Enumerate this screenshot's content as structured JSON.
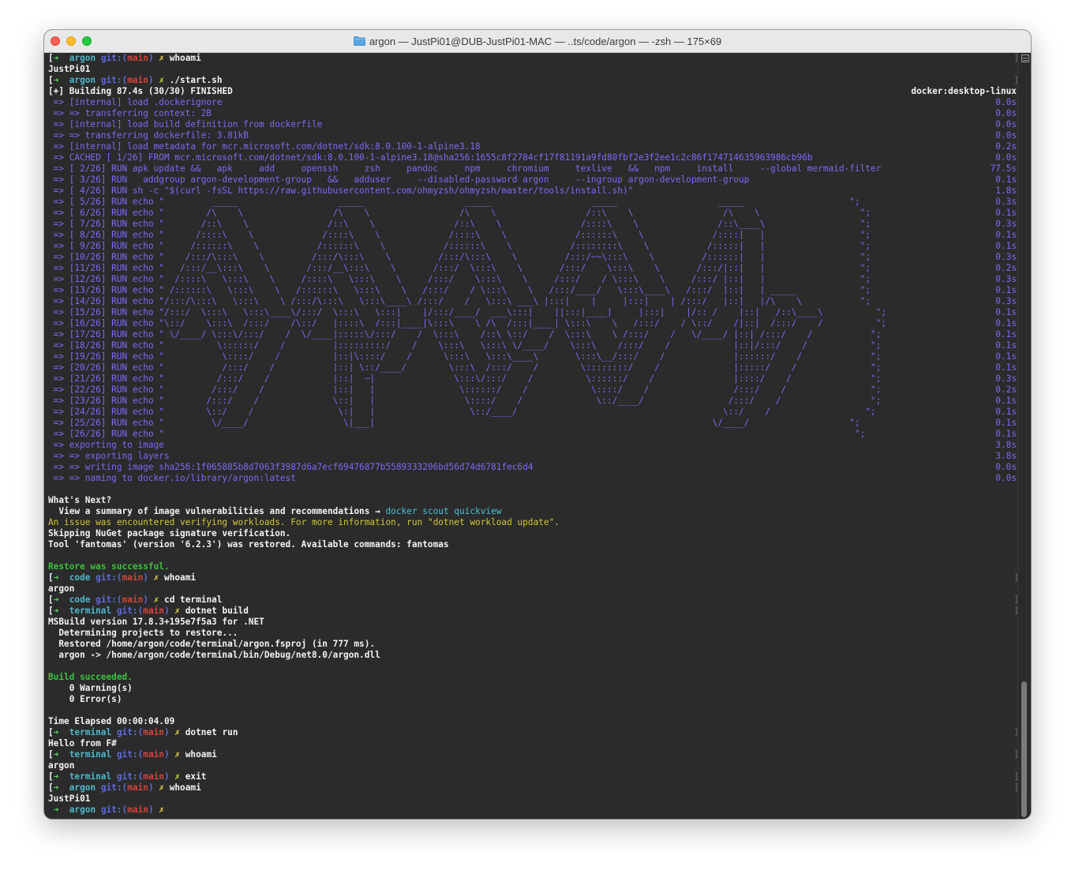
{
  "window": {
    "title": "argon — JustPi01@DUB-JustPi01-MAC — ..ts/code/argon — -zsh — 175×69",
    "icon": "folder-icon"
  },
  "terminal": {
    "lines": [
      {
        "type": "prompt",
        "dir": "argon",
        "branch": "main",
        "cmd": "whoami"
      },
      {
        "type": "plain",
        "text": "JustPi01"
      },
      {
        "type": "prompt",
        "dir": "argon",
        "branch": "main",
        "cmd": "./start.sh"
      },
      {
        "type": "plain",
        "text": "[+] Building 87.4s (30/30) FINISHED",
        "right": "docker:desktop-linux",
        "rightColor": "white"
      },
      {
        "type": "build",
        "text": " => [internal] load .dockerignore",
        "time": "0.0s"
      },
      {
        "type": "build",
        "text": " => => transferring context: 2B",
        "time": "0.0s"
      },
      {
        "type": "build",
        "text": " => [internal] load build definition from dockerfile",
        "time": "0.0s"
      },
      {
        "type": "build",
        "text": " => => transferring dockerfile: 3.81kB",
        "time": "0.0s"
      },
      {
        "type": "build",
        "text": " => [internal] load metadata for mcr.microsoft.com/dotnet/sdk:8.0.100-1-alpine3.18",
        "time": "0.2s"
      },
      {
        "type": "build",
        "text": " => CACHED [ 1/26] FROM mcr.microsoft.com/dotnet/sdk:8.0.100-1-alpine3.18@sha256:1655c8f2784cf17f81191a9fd80fbf2e3f2ee1c2c86f174714635963986cb96b",
        "time": "0.0s"
      },
      {
        "type": "build",
        "text": " => [ 2/26] RUN apk update &&   apk     add     openssh     zsh     pandoc     npm     chromium     texlive   &&   npm     install     --global mermaid-filter",
        "time": "77.5s"
      },
      {
        "type": "build",
        "text": " => [ 3/26] RUN   addgroup argon-development-group   &&   adduser     --disabled-password argon     --ingroup argon-development-group",
        "time": "0.1s"
      },
      {
        "type": "build",
        "text": " => [ 4/26] RUN sh -c \"$(curl -fsSL https://raw.githubusercontent.com/ohmyzsh/ohmyzsh/master/tools/install.sh)\"",
        "time": "1.8s"
      },
      {
        "type": "build",
        "text": " => [ 5/26] RUN echo \"         _____                   _____                   _____                   _____                   _____                    \";",
        "time": "0.3s"
      },
      {
        "type": "build",
        "text": " => [ 6/26] RUN echo \"        /\\    \\                 /\\    \\                 /\\    \\                 /::\\    \\                 /\\    \\                   \";",
        "time": "0.1s"
      },
      {
        "type": "build",
        "text": " => [ 7/26] RUN echo \"       /::\\    \\               /::\\    \\               /::\\    \\               /::::\\    \\               /::\\____\\                  \";",
        "time": "0.3s"
      },
      {
        "type": "build",
        "text": " => [ 8/26] RUN echo \"      /::::\\    \\             /::::\\    \\             /::::\\    \\             /::::::\\    \\             /::::|   |                  \";",
        "time": "0.1s"
      },
      {
        "type": "build",
        "text": " => [ 9/26] RUN echo \"     /::::::\\    \\           /::::::\\    \\           /::::::\\    \\           /::::::::\\    \\           /:::::|   |                  \";",
        "time": "0.1s"
      },
      {
        "type": "build",
        "text": " => [10/26] RUN echo \"    /:::/\\:::\\    \\         /:::/\\:::\\    \\         /:::/\\:::\\    \\         /:::/~~\\:::\\    \\         /::::::|   |                  \";",
        "time": "0.3s"
      },
      {
        "type": "build",
        "text": " => [11/26] RUN echo \"   /:::/__\\:::\\    \\       /:::/__\\:::\\    \\       /:::/  \\:::\\    \\       /:::/    \\:::\\    \\       /:::/|::|   |                  \";",
        "time": "0.2s"
      },
      {
        "type": "build",
        "text": " => [12/26] RUN echo \"  /::::\\   \\:::\\    \\     /::::\\   \\:::\\    \\     /:::/    \\:::\\    \\     /:::/    / \\:::\\    \\     /:::/ |::|   |                  \";",
        "time": "0.3s"
      },
      {
        "type": "build",
        "text": " => [13/26] RUN echo \" /::::::\\   \\:::\\    \\   /::::::\\   \\:::\\    \\   /:::/    / \\:::\\    \\   /:::/____/   \\:::\\____\\   /:::/  |::|   | _____            \";",
        "time": "0.1s"
      },
      {
        "type": "build",
        "text": " => [14/26] RUN echo \"/:::/\\:::\\   \\:::\\    \\ /:::/\\:::\\   \\:::\\____\\ /:::/    /   \\:::\\ ___\\ |:::|    |     |:::|    | /:::/   |::|   |/\\    \\           \";",
        "time": "0.3s"
      },
      {
        "type": "build",
        "text": " => [15/26] RUN echo \"/:::/  \\:::\\   \\:::\\____\\/:::/  \\:::\\   \\:::|    |/:::/____/  ___\\:::|    ||:::|____|     |:::|    |/:: /    |::|   /::\\____\\          \";",
        "time": "0.1s"
      },
      {
        "type": "build",
        "text": " => [16/26] RUN echo \"\\::/    \\:::\\  /:::/    /\\::/   |::::\\  /:::|____|\\:::\\    \\ /\\  /:::|____| \\:::\\    \\   /:::/    / \\::/    /|::|  /:::/    /          \";",
        "time": "0.1s"
      },
      {
        "type": "build",
        "text": " => [17/26] RUN echo \" \\/____/ \\:::\\/:::/    /  \\/____|:::::\\/:::/    /  \\:::\\    /::\\ \\::/    /  \\:::\\    \\ /:::/    /   \\/____/ |::| /:::/    /           \";",
        "time": "0.1s"
      },
      {
        "type": "build",
        "text": " => [18/26] RUN echo \"          \\::::::/    /         |:::::::::/    /    \\:::\\   \\:::\\ \\/____/    \\:::\\    /:::/    /            |::|/:::/    /            \";",
        "time": "0.1s"
      },
      {
        "type": "build",
        "text": " => [19/26] RUN echo \"           \\::::/    /          |::|\\::::/    /      \\:::\\   \\:::\\____\\       \\:::\\__/:::/    /             |::::::/    /             \";",
        "time": "0.1s"
      },
      {
        "type": "build",
        "text": " => [20/26] RUN echo \"           /:::/    /           |::| \\::/____/        \\:::\\  /:::/    /        \\::::::::/    /              |:::::/    /              \";",
        "time": "0.1s"
      },
      {
        "type": "build",
        "text": " => [21/26] RUN echo \"          /:::/    /            |::|  ~|               \\:::\\/:::/    /          \\::::::/    /               |::::/    /               \";",
        "time": "0.3s"
      },
      {
        "type": "build",
        "text": " => [22/26] RUN echo \"         /:::/    /             |::|   |                \\::::::/    /            \\::::/    /                /:::/    /                \";",
        "time": "0.2s"
      },
      {
        "type": "build",
        "text": " => [23/26] RUN echo \"        /:::/    /              \\::|   |                 \\::::/    /              \\::/____/                /:::/    /                 \";",
        "time": "0.1s"
      },
      {
        "type": "build",
        "text": " => [24/26] RUN echo \"        \\::/    /                \\:|   |                  \\::/____/                                       \\::/    /                  \";",
        "time": "0.1s"
      },
      {
        "type": "build",
        "text": " => [25/26] RUN echo \"         \\/____/                  \\|___|                                                                \\/____/                   \";",
        "time": "0.1s"
      },
      {
        "type": "build",
        "text": " => [26/26] RUN echo \"                                                                                                                                   \";",
        "time": "0.1s"
      },
      {
        "type": "build",
        "text": " => exporting to image",
        "time": "3.8s"
      },
      {
        "type": "build",
        "text": " => => exporting layers",
        "time": "3.8s"
      },
      {
        "type": "build",
        "text": " => => writing image sha256:1f065885b8d7063f3987d6a7ecf69476877b5589333206bd56d74d6781fec6d4",
        "time": "0.0s"
      },
      {
        "type": "build",
        "text": " => => naming to docker.io/library/argon:latest",
        "time": "0.0s"
      },
      {
        "type": "blank"
      },
      {
        "type": "plain",
        "text": "What's Next?"
      },
      {
        "type": "next",
        "text": "  View a summary of image vulnerabilities and recommendations → ",
        "link": "docker scout quickview"
      },
      {
        "type": "warn",
        "text": "An issue was encountered verifying workloads. For more information, run \"dotnet workload update\"."
      },
      {
        "type": "plain",
        "text": "Skipping NuGet package signature verification."
      },
      {
        "type": "plain",
        "text": "Tool 'fantomas' (version '6.2.3') was restored. Available commands: fantomas"
      },
      {
        "type": "blank"
      },
      {
        "type": "success",
        "text": "Restore was successful."
      },
      {
        "type": "prompt",
        "dir": "code",
        "branch": "main",
        "cmd": "whoami"
      },
      {
        "type": "plain",
        "text": "argon"
      },
      {
        "type": "prompt",
        "dir": "code",
        "branch": "main",
        "cmd": "cd terminal"
      },
      {
        "type": "prompt",
        "dir": "terminal",
        "branch": "main",
        "cmd": "dotnet build"
      },
      {
        "type": "plain",
        "text": "MSBuild version 17.8.3+195e7f5a3 for .NET"
      },
      {
        "type": "plain",
        "text": "  Determining projects to restore..."
      },
      {
        "type": "plain",
        "text": "  Restored /home/argon/code/terminal/argon.fsproj (in 777 ms)."
      },
      {
        "type": "plain",
        "text": "  argon -> /home/argon/code/terminal/bin/Debug/net8.0/argon.dll"
      },
      {
        "type": "blank"
      },
      {
        "type": "success",
        "text": "Build succeeded."
      },
      {
        "type": "plain",
        "text": "    0 Warning(s)"
      },
      {
        "type": "plain",
        "text": "    0 Error(s)"
      },
      {
        "type": "blank"
      },
      {
        "type": "plain",
        "text": "Time Elapsed 00:00:04.09"
      },
      {
        "type": "prompt",
        "dir": "terminal",
        "branch": "main",
        "cmd": "dotnet run"
      },
      {
        "type": "plain",
        "text": "Hello from F#"
      },
      {
        "type": "prompt",
        "dir": "terminal",
        "branch": "main",
        "cmd": "whoami"
      },
      {
        "type": "plain",
        "text": "argon"
      },
      {
        "type": "prompt",
        "dir": "terminal",
        "branch": "main",
        "cmd": "exit"
      },
      {
        "type": "prompt",
        "dir": "argon",
        "branch": "main",
        "cmd": "whoami"
      },
      {
        "type": "plain",
        "text": "JustPi01"
      },
      {
        "type": "prompt",
        "dir": "argon",
        "branch": "main",
        "cmd": "",
        "current": true
      }
    ]
  },
  "prompt": {
    "arrow": "➜",
    "git_label": "git:",
    "dirty_mark": "✗",
    "mark_bracket": "["
  },
  "colors": {
    "background": "#2b2b2b",
    "prompt_arrow": "#5fd75f",
    "dir": "#4fb6c9",
    "git": "#5d6ad9",
    "branch": "#d0453a",
    "dirty": "#e0d84a",
    "build_output": "#7a6bf5",
    "warning": "#cfc836",
    "success": "#3fbf3f",
    "link": "#49c1d6"
  },
  "scrollbar": {
    "position_fraction": 0.83
  }
}
